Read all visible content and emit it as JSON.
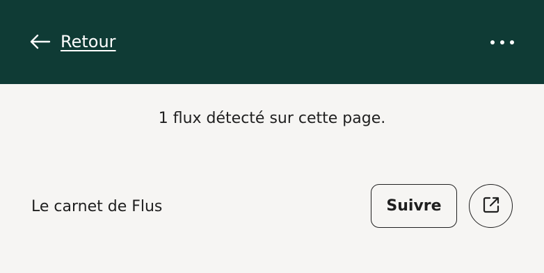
{
  "header": {
    "back_label": "Retour",
    "back_icon": "arrow-left-icon",
    "menu_icon": "more-horizontal-icon"
  },
  "info": {
    "text": "1 flux détecté sur cette page."
  },
  "feeds": [
    {
      "name": "Le carnet de Flus",
      "follow_label": "Suivre",
      "external_icon": "external-link-icon"
    }
  ],
  "colors": {
    "header_bg": "#0f3b35",
    "page_bg": "#f6f5f3",
    "text": "#1f1f1f"
  }
}
